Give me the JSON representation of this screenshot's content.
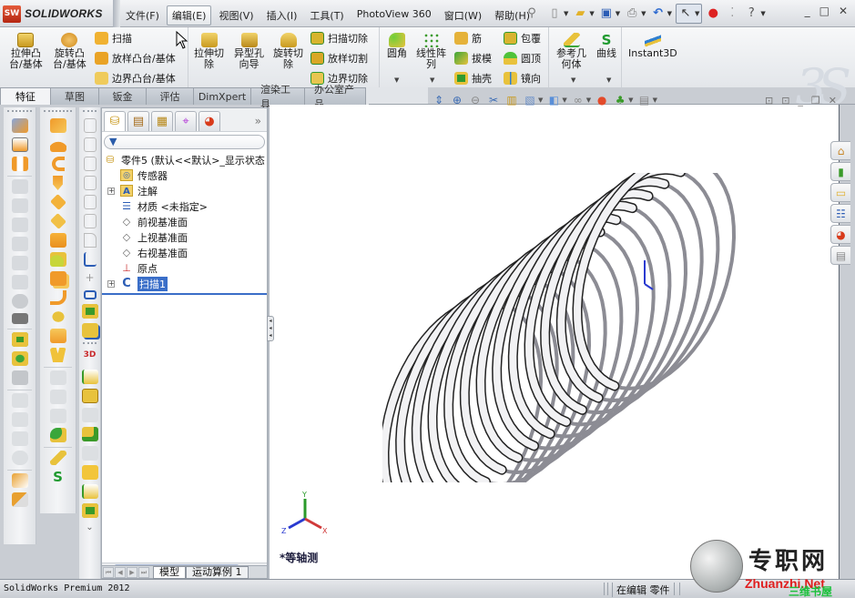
{
  "app": {
    "brand_badge": "SW",
    "brand_name": "SOLIDWORKS"
  },
  "menu": [
    {
      "label": "文件(F)",
      "active": false
    },
    {
      "label": "编辑(E)",
      "active": true
    },
    {
      "label": "视图(V)",
      "active": false
    },
    {
      "label": "插入(I)",
      "active": false
    },
    {
      "label": "工具(T)",
      "active": false
    },
    {
      "label": "PhotoView 360",
      "active": false
    },
    {
      "label": "窗口(W)",
      "active": false
    },
    {
      "label": "帮助(H)",
      "active": false
    }
  ],
  "quick_access": {
    "pin": "pushpin-icon",
    "new": "new-document-icon",
    "open": "open-folder-icon",
    "save": "save-icon",
    "print": "print-icon",
    "undo": "undo-icon",
    "select": "select-pointer-icon",
    "rebuild": "rebuild-traffic-light-icon",
    "help": "help-icon"
  },
  "window_controls": {
    "minimize": "_",
    "restore": "□",
    "close": "✕"
  },
  "command_manager": {
    "extrude_boss": "拉伸凸\n台/基体",
    "revolve_boss": "旋转凸\n台/基体",
    "sweep": "扫描",
    "loft_boss": "放样凸台/基体",
    "boundary_boss": "边界凸台/基体",
    "extrude_cut": "拉伸切\n除",
    "hole_wizard": "异型孔\n向导",
    "revolve_cut": "旋转切\n除",
    "sweep_cut": "扫描切除",
    "loft_cut": "放样切割",
    "boundary_cut": "边界切除",
    "fillet": "圆角",
    "linear_pattern": "线性阵\n列",
    "rib": "筋",
    "draft": "拔模",
    "shell": "抽壳",
    "wrap": "包覆",
    "dome": "圆顶",
    "mirror": "镜向",
    "ref_geometry": "参考几\n何体",
    "curves": "曲线",
    "instant3d": "Instant3D"
  },
  "tabs": [
    {
      "label": "特征",
      "active": true
    },
    {
      "label": "草图",
      "active": false
    },
    {
      "label": "钣金",
      "active": false
    },
    {
      "label": "评估",
      "active": false
    },
    {
      "label": "DimXpert",
      "active": false
    },
    {
      "label": "渲染工具",
      "active": false
    },
    {
      "label": "办公室产品",
      "active": false
    }
  ],
  "feature_manager": {
    "tabs": [
      "featuremanager-tree-icon",
      "propertymanager-icon",
      "configurationmanager-icon",
      "dimxpertmanager-icon",
      "displaymanager-icon"
    ],
    "more": "»",
    "filter_icon": "filter-icon",
    "root": "零件5   (默认<<默认>_显示状态",
    "items": [
      {
        "label": "传感器",
        "icon": "sensors-folder-icon",
        "expandable": false
      },
      {
        "label": "注解",
        "icon": "annotations-icon",
        "expandable": true
      },
      {
        "label": "材质 <未指定>",
        "icon": "material-icon",
        "expandable": false
      },
      {
        "label": "前视基准面",
        "icon": "plane-icon",
        "expandable": false
      },
      {
        "label": "上视基准面",
        "icon": "plane-icon",
        "expandable": false
      },
      {
        "label": "右视基准面",
        "icon": "plane-icon",
        "expandable": false
      },
      {
        "label": "原点",
        "icon": "origin-icon",
        "expandable": false
      },
      {
        "label": "扫描1",
        "icon": "sweep-feature-icon",
        "expandable": true,
        "selected": true
      }
    ],
    "bottom_tabs": [
      {
        "label": "模型",
        "active": true
      },
      {
        "label": "运动算例 1",
        "active": false
      }
    ]
  },
  "viewport": {
    "view_name": "*等轴测",
    "triad": {
      "x": "X",
      "y": "Y",
      "z": "Z"
    },
    "model": "helical sweep spring"
  },
  "headsup_toolbar": [
    "zoom-to-fit-icon",
    "zoom-to-area-icon",
    "previous-view-icon",
    "section-view-icon",
    "dynamic-annotation-icon",
    "view-orientation-icon",
    "display-style-icon",
    "hide-show-items-icon",
    "edit-appearance-icon",
    "apply-scene-icon",
    "view-settings-icon"
  ],
  "task_pane": [
    "solidworks-resources-icon",
    "design-library-icon",
    "file-explorer-icon",
    "view-palette-icon",
    "appearances-scenes-icon",
    "custom-properties-icon"
  ],
  "status_bar": {
    "product": "SolidWorks Premium 2012",
    "mode": "在编辑 零件"
  },
  "watermark": {
    "cn": "专职网",
    "en": "Zhuanzhi.Net",
    "sub": "三维书屋"
  }
}
